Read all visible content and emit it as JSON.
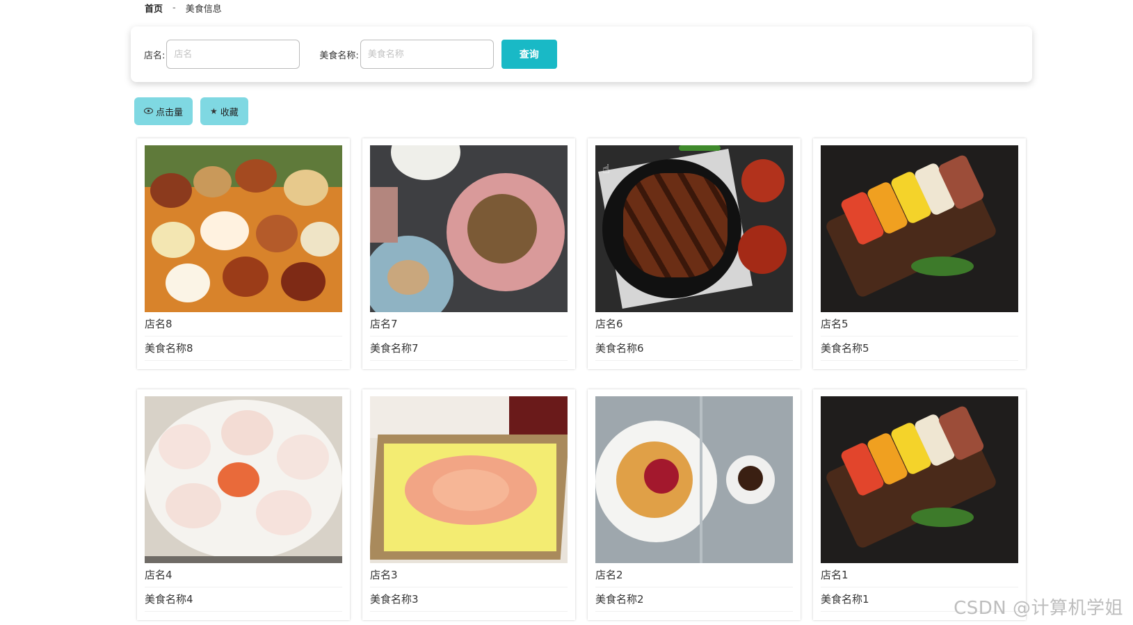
{
  "breadcrumb": {
    "home": "首页",
    "separator": "-",
    "current": "美食信息"
  },
  "search": {
    "shop_label": "店名:",
    "shop_placeholder": "店名",
    "shop_value": "",
    "food_label": "美食名称:",
    "food_placeholder": "美食名称",
    "food_value": "",
    "query_button": "查询"
  },
  "sort_buttons": {
    "clicks_icon": "eye-icon",
    "clicks_label": "点击量",
    "favorite_icon": "star-icon",
    "favorite_label": "收藏"
  },
  "cards": [
    {
      "shop": "店名8",
      "food": "美食名称8"
    },
    {
      "shop": "店名7",
      "food": "美食名称7"
    },
    {
      "shop": "店名6",
      "food": "美食名称6"
    },
    {
      "shop": "店名5",
      "food": "美食名称5"
    },
    {
      "shop": "店名4",
      "food": "美食名称4"
    },
    {
      "shop": "店名3",
      "food": "美食名称3"
    },
    {
      "shop": "店名2",
      "food": "美食名称2"
    },
    {
      "shop": "店名1",
      "food": "美食名称1"
    }
  ],
  "watermark": "CSDN @计算机学姐",
  "colors": {
    "accent": "#19b9c6",
    "sort_button_bg": "#7fd8e2"
  }
}
